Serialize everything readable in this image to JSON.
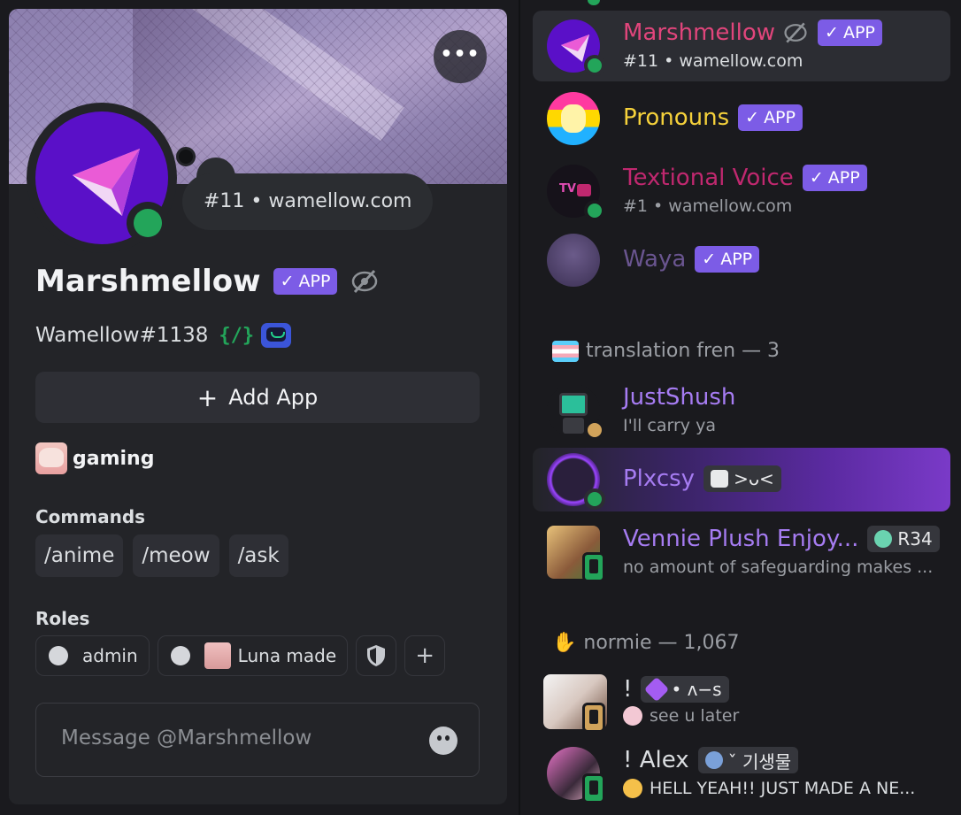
{
  "profile": {
    "more_label": "•••",
    "custom_status": "#11 • wamellow.com",
    "display_name": "Marshmellow",
    "app_badge": "APP",
    "username": "Wamellow#1138",
    "dev_badge": "{/}",
    "add_app_label": "Add App",
    "activity_label": "gaming",
    "commands_heading": "Commands",
    "commands": [
      "/anime",
      "/meow",
      "/ask"
    ],
    "roles_heading": "Roles",
    "roles": [
      "admin",
      "Luna made"
    ],
    "message_placeholder": "Message @Marshmellow"
  },
  "members": {
    "apps": [
      {
        "name": "Marshmellow",
        "badge": "APP",
        "sub": "#11 • wamellow.com",
        "color": "#e0457b"
      },
      {
        "name": "Pronouns",
        "badge": "APP",
        "sub": "",
        "color": "#f5d13b"
      },
      {
        "name": "Textional Voice",
        "badge": "APP",
        "sub": "#1 • wamellow.com",
        "color": "#c0286f"
      },
      {
        "name": "Waya",
        "badge": "APP",
        "sub": "",
        "color": "#6a5590"
      }
    ],
    "group_translation": "translation fren — 3",
    "translation": [
      {
        "name": "JustShush",
        "sub": "I'll carry ya",
        "color": "#a67cf2"
      },
      {
        "name": "Plxcsy",
        "tag": ">ᴗ<",
        "sub": "",
        "color": "#a67cf2"
      },
      {
        "name": "Vennie Plush Enjoy...",
        "tag": "R34",
        "sub": "no amount of safeguarding makes ...",
        "color": "#a67cf2"
      }
    ],
    "group_normie": "normie — 1,067",
    "normie": [
      {
        "name": "!",
        "tag": "• ʌ−s",
        "sub": "see u later",
        "color": "#dbdee1"
      },
      {
        "name": "! Alex",
        "tag": "ˇ 기생물",
        "sub": "HELL YEAH!! JUST MADE A NE...",
        "color": "#dbdee1"
      }
    ]
  },
  "colors": {
    "online": "#23a55a",
    "idle": "#d1a35b",
    "app_badge": "#7c5ce6",
    "avatar_bg": "#5a10c8"
  }
}
